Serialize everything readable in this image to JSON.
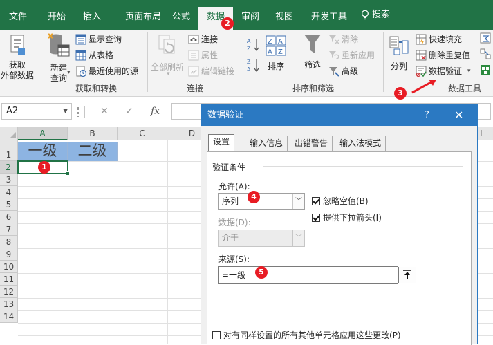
{
  "ribbon_tabs": [
    "文件",
    "开始",
    "插入",
    "页面布局",
    "公式",
    "数据",
    "审阅",
    "视图",
    "开发工具"
  ],
  "tell_me": "搜索",
  "groups": {
    "get_transform": {
      "label": "获取和转换",
      "get_external": "获取\n外部数据",
      "new_query": "新建\n查询",
      "show_queries": "显示查询",
      "from_table": "从表格",
      "recent_sources": "最近使用的源"
    },
    "connections": {
      "label": "连接",
      "refresh_all": "全部刷新",
      "connections": "连接",
      "properties": "属性",
      "edit_links": "编辑链接"
    },
    "sort_filter": {
      "label": "排序和筛选",
      "sort": "排序",
      "filter": "筛选",
      "clear": "清除",
      "reapply": "重新应用",
      "advanced": "高级"
    },
    "data_tools": {
      "label": "数据工具",
      "text_to_columns": "分列",
      "flash_fill": "快速填充",
      "remove_duplicates": "删除重复值",
      "data_validation": "数据验证"
    }
  },
  "formula_bar": {
    "name_box": "A2",
    "fx": "fx"
  },
  "sheet": {
    "columns": [
      "A",
      "B",
      "C",
      "D"
    ],
    "rows": [
      "1",
      "2",
      "3",
      "4",
      "5",
      "6",
      "7",
      "8",
      "9",
      "10",
      "11",
      "12",
      "13",
      "14"
    ],
    "cells": {
      "A1": "一级",
      "B1": "二级"
    },
    "partial_col": "I"
  },
  "dialog": {
    "title": "数据验证",
    "help": "?",
    "close": "✕",
    "tabs": [
      "设置",
      "输入信息",
      "出错警告",
      "输入法模式"
    ],
    "group_title": "验证条件",
    "allow_label": "允许(A):",
    "allow_value": "序列",
    "data_label": "数据(D):",
    "data_value": "介于",
    "ignore_blank": "忽略空值(B)",
    "in_cell_dropdown": "提供下拉箭头(I)",
    "source_label": "来源(S):",
    "source_value": "=一级",
    "apply_all": "对有同样设置的所有其他单元格应用这些更改(P)"
  },
  "steps": [
    "1",
    "2",
    "3",
    "4",
    "5"
  ],
  "colors": {
    "excel_green": "#217346",
    "dialog_blue": "#2b79c2",
    "header_fill": "#8db4e2",
    "badge_red": "#e81c24"
  }
}
